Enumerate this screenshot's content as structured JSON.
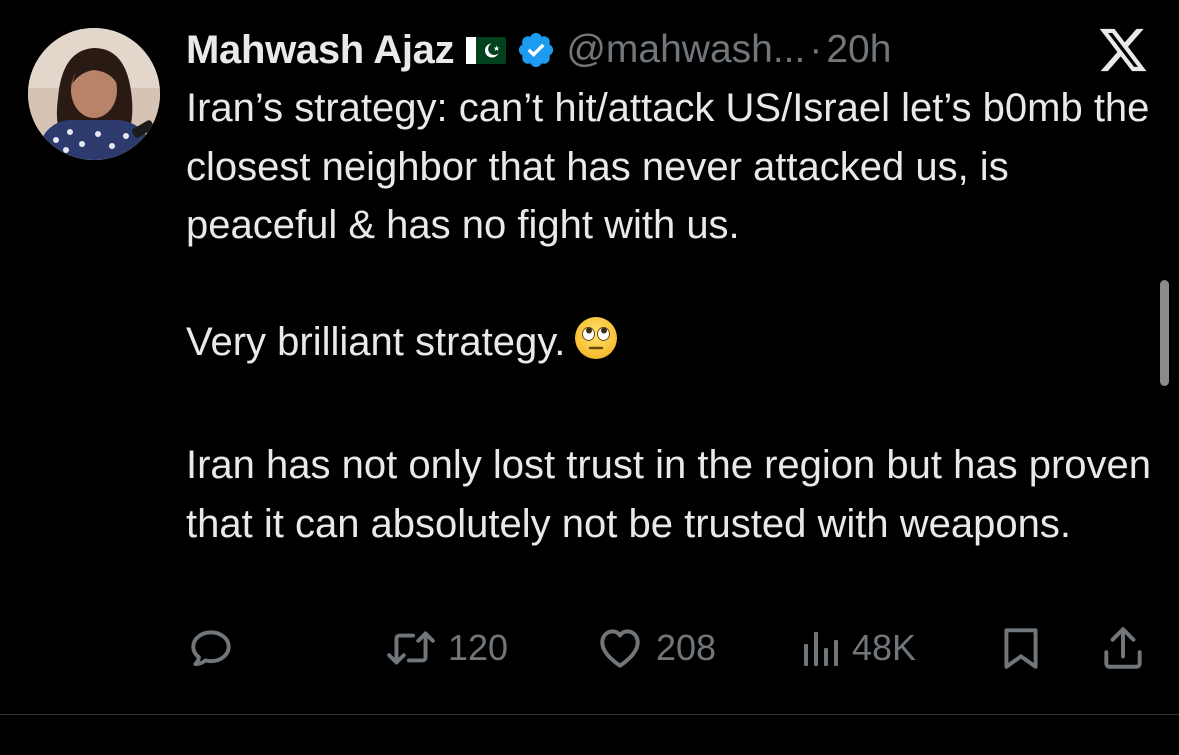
{
  "tweet": {
    "author": {
      "display_name": "Mahwash Ajaz",
      "flag_icon": "pakistan-flag-icon",
      "verified_icon": "verified-badge-icon",
      "handle": "@mahwash...",
      "separator": "·",
      "timestamp": "20h"
    },
    "platform_logo": "x-logo-icon",
    "paragraphs": [
      "Iran’s strategy: can’t hit/attack US/Israel let’s b0mb the closest neighbor that has never attacked us, is peaceful & has no fight with us.",
      "Very brilliant strategy.",
      "Iran has not only lost trust in the region but has proven that it can absolutely not be trusted with weapons."
    ],
    "emoji": "face-with-rolling-eyes-emoji",
    "actions": {
      "reply": {
        "icon": "reply-icon"
      },
      "retweet": {
        "icon": "retweet-icon",
        "count": "120"
      },
      "like": {
        "icon": "heart-icon",
        "count": "208"
      },
      "views": {
        "icon": "views-icon",
        "count": "48K"
      },
      "bookmark": {
        "icon": "bookmark-icon"
      },
      "share": {
        "icon": "share-icon"
      }
    }
  },
  "colors": {
    "background": "#000000",
    "text_primary": "#e7e9ea",
    "text_secondary": "#71767b",
    "verified_blue": "#1d9bf0",
    "divider": "#2f3336"
  }
}
